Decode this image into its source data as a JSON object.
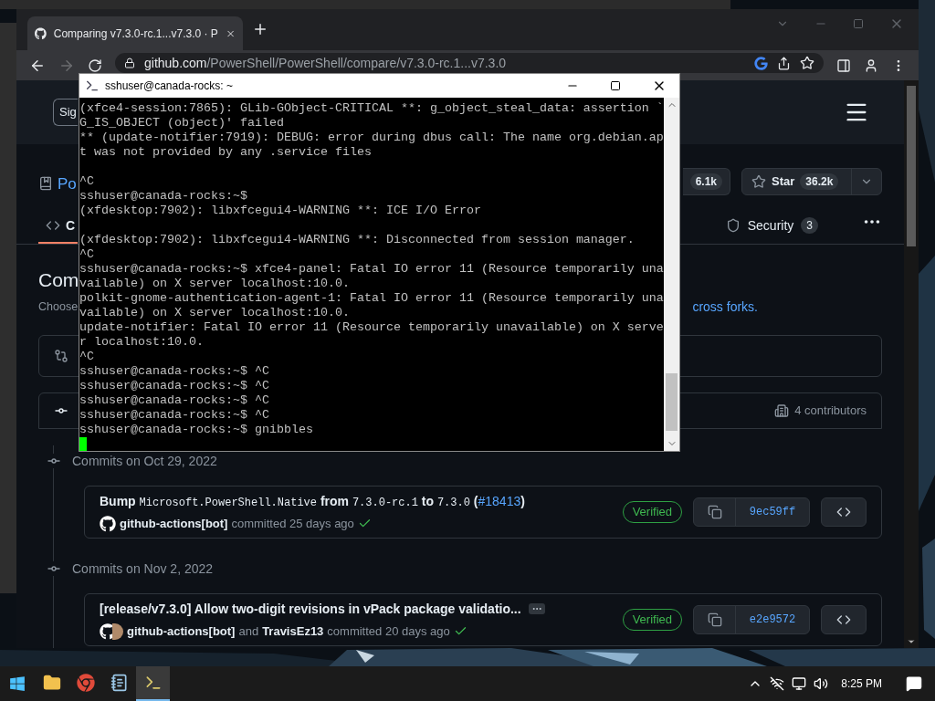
{
  "browser": {
    "tab": {
      "title": "Comparing v7.3.0-rc.1...v7.3.0 · P",
      "selected": true
    },
    "forward": {
      "disabled": true
    },
    "address": {
      "domain": "github.com",
      "path": "/PowerShell/PowerShell/compare/v7.3.0-rc.1...v7.3.0"
    }
  },
  "github": {
    "sign_in": "Sig",
    "repo_name": "Po",
    "fork": {
      "count": "6.1k"
    },
    "star": {
      "label": "Star",
      "count": "36.2k"
    },
    "tabs": [
      {
        "kind": "code",
        "label": "C",
        "selected": true
      },
      {
        "kind": "security",
        "label": "Security",
        "count": "3",
        "selected": false
      }
    ],
    "heading": "Com",
    "subtitle": "Choose",
    "link": "cross forks.",
    "contributors": "4 contributors",
    "commit_groups": [
      {
        "date": "Commits on Oct 29, 2022",
        "commits": [
          {
            "title": [
              {
                "kind": "text",
                "text": "Bump "
              },
              {
                "kind": "code",
                "text": "Microsoft.PowerShell.Native"
              },
              {
                "kind": "text",
                "text": " from "
              },
              {
                "kind": "code",
                "text": "7.3.0-rc.1"
              },
              {
                "kind": "text",
                "text": " to "
              },
              {
                "kind": "code",
                "text": "7.3.0"
              },
              {
                "kind": "text",
                "text": " ("
              },
              {
                "kind": "link",
                "text": "#18413"
              },
              {
                "kind": "text",
                "text": ")"
              }
            ],
            "truncated": false,
            "avatars": [
              {
                "kind": "github"
              }
            ],
            "byline": [
              {
                "kind": "author",
                "text": "github-actions[bot]"
              },
              {
                "kind": "text",
                "text": "committed 25 days ago"
              }
            ],
            "passed": true,
            "verified": "Verified",
            "sha": "9ec59ff"
          }
        ]
      },
      {
        "date": "Commits on Nov 2, 2022",
        "commits": [
          {
            "title": [
              {
                "kind": "text",
                "text": "[release/v7.3.0] Allow two-digit revisions in vPack package validatio..."
              }
            ],
            "truncated": true,
            "avatars": [
              {
                "kind": "github"
              },
              {
                "kind": "person"
              }
            ],
            "byline": [
              {
                "kind": "author",
                "text": "github-actions[bot]"
              },
              {
                "kind": "text",
                "text": "and"
              },
              {
                "kind": "author",
                "text": "TravisEz13"
              },
              {
                "kind": "text",
                "text": "committed 20 days ago"
              }
            ],
            "passed": true,
            "verified": "Verified",
            "sha": "e2e9572"
          }
        ]
      }
    ]
  },
  "terminal": {
    "title": "sshuser@canada-rocks: ~",
    "cursor": true,
    "lines": [
      {
        "kind": "text",
        "text": "(xfce4-session:7865): GLib-GObject-CRITICAL **: g_object_steal_data: assertion `"
      },
      {
        "kind": "text",
        "text": "G_IS_OBJECT (object)' failed"
      },
      {
        "kind": "text",
        "text": "** (update-notifier:7919): DEBUG: error during dbus call: The name org.debian.ap"
      },
      {
        "kind": "text",
        "text": "t was not provided by any .service files"
      },
      {
        "kind": "blank"
      },
      {
        "kind": "text",
        "text": "^C"
      },
      {
        "kind": "text",
        "text": "sshuser@canada-rocks:~$"
      },
      {
        "kind": "text",
        "text": "(xfdesktop:7902): libxfcegui4-WARNING **: ICE I/O Error"
      },
      {
        "kind": "blank"
      },
      {
        "kind": "text",
        "text": "(xfdesktop:7902): libxfcegui4-WARNING **: Disconnected from session manager."
      },
      {
        "kind": "text",
        "text": "^C"
      },
      {
        "kind": "text",
        "text": "sshuser@canada-rocks:~$ xfce4-panel: Fatal IO error 11 (Resource temporarily una"
      },
      {
        "kind": "text",
        "text": "vailable) on X server localhost:10.0."
      },
      {
        "kind": "text",
        "text": "polkit-gnome-authentication-agent-1: Fatal IO error 11 (Resource temporarily una"
      },
      {
        "kind": "text",
        "text": "vailable) on X server localhost:10.0."
      },
      {
        "kind": "text",
        "text": "update-notifier: Fatal IO error 11 (Resource temporarily unavailable) on X serve"
      },
      {
        "kind": "text",
        "text": "r localhost:10.0."
      },
      {
        "kind": "text",
        "text": "^C"
      },
      {
        "kind": "text",
        "text": "sshuser@canada-rocks:~$ ^C"
      },
      {
        "kind": "text",
        "text": "sshuser@canada-rocks:~$ ^C"
      },
      {
        "kind": "text",
        "text": "sshuser@canada-rocks:~$ ^C"
      },
      {
        "kind": "text",
        "text": "sshuser@canada-rocks:~$ ^C"
      },
      {
        "kind": "text",
        "text": "sshuser@canada-rocks:~$ gnibbles"
      }
    ]
  },
  "taskbar": {
    "apps": [
      {
        "kind": "explorer",
        "selected": false
      },
      {
        "kind": "chrome",
        "selected": false
      },
      {
        "kind": "notepad",
        "selected": false
      },
      {
        "kind": "putty",
        "selected": true
      }
    ],
    "clock": "8:25 PM"
  }
}
